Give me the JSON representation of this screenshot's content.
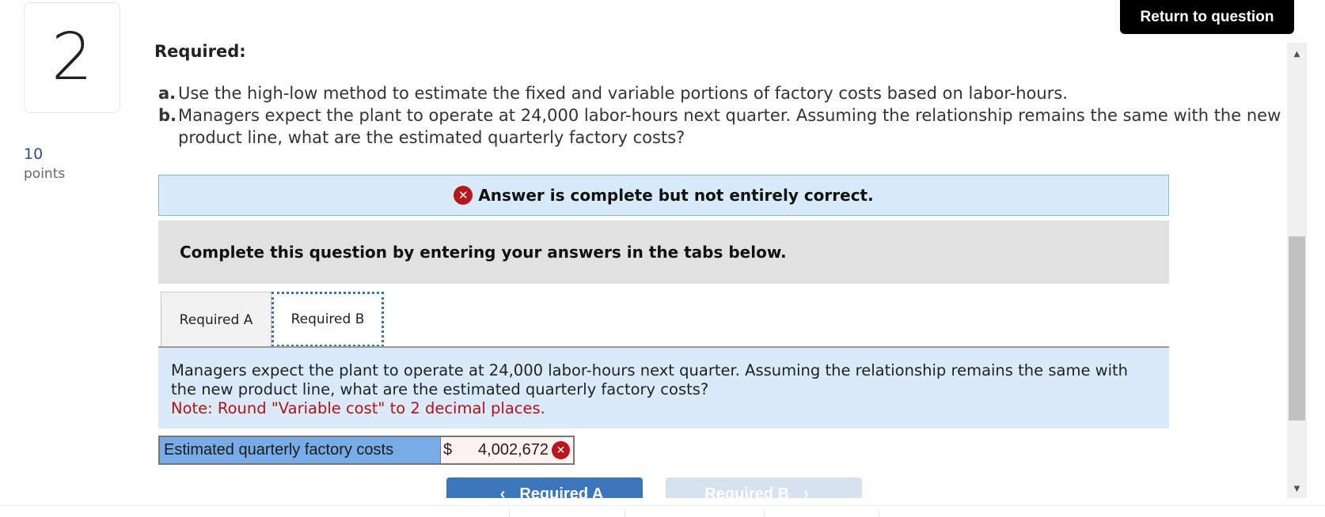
{
  "question": {
    "number": "2",
    "points_value": "10",
    "points_label": "points"
  },
  "header": {
    "return_button": "Return to question"
  },
  "required": {
    "title": "Required:",
    "items": [
      {
        "label": "a.",
        "text": "Use the high-low method to estimate the fixed and variable portions of factory costs based on labor-hours."
      },
      {
        "label": "b.",
        "text": "Managers expect the plant to operate at 24,000 labor-hours next quarter. Assuming the relationship remains the same with the new product line, what are the estimated quarterly factory costs?"
      }
    ]
  },
  "alert": {
    "icon": "x-circle-icon",
    "text": "Answer is complete but not entirely correct."
  },
  "instruction": "Complete this question by entering your answers in the tabs below.",
  "tabs": [
    {
      "label": "Required A",
      "active": false
    },
    {
      "label": "Required B",
      "active": true
    }
  ],
  "content": {
    "question_text": "Managers expect the plant to operate at 24,000 labor-hours next quarter. Assuming the relationship remains the same with the new product line, what are the estimated quarterly factory costs?",
    "note": "Note: Round \"Variable cost\" to 2 decimal places."
  },
  "answer": {
    "label": "Estimated quarterly factory costs",
    "currency": "$",
    "value": "4,002,672",
    "status": "incorrect",
    "status_icon": "x-circle-icon"
  },
  "navigation": {
    "prev_label": "Required A",
    "prev_chevron": "‹",
    "next_label": "Required B",
    "next_chevron": "›"
  },
  "colors": {
    "error": "#b8161c",
    "primary_button": "#3a76b9",
    "answer_label_bg": "#78ace6",
    "alert_bg": "#d9ebf9"
  }
}
